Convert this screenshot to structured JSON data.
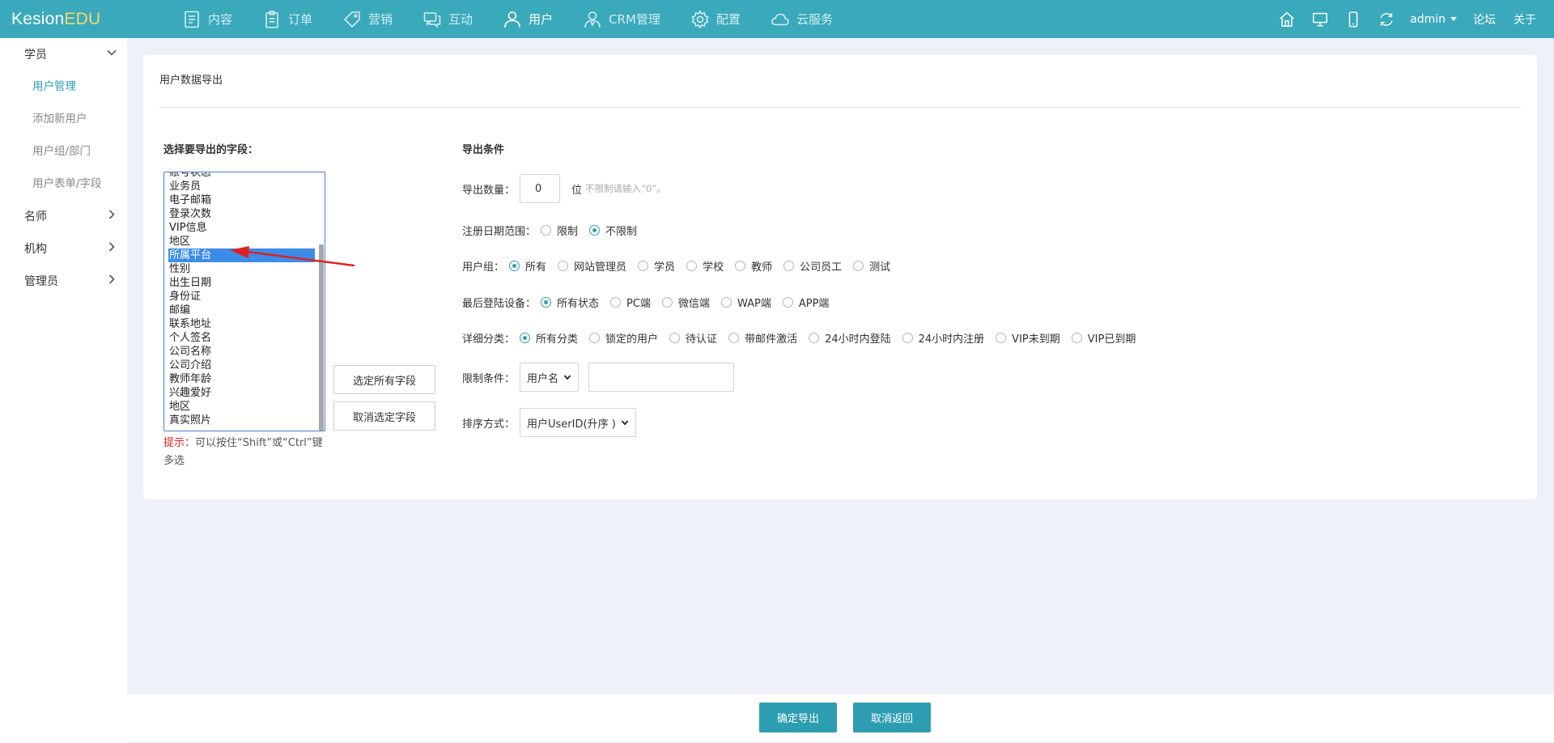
{
  "app": {
    "logo_main": "Kesion",
    "logo_accent": "EDU"
  },
  "nav": [
    {
      "label": "内容",
      "icon": "document-icon",
      "active": false
    },
    {
      "label": "订单",
      "icon": "clipboard-icon",
      "active": false
    },
    {
      "label": "营销",
      "icon": "tag-icon",
      "active": false
    },
    {
      "label": "互动",
      "icon": "chat-icon",
      "active": false
    },
    {
      "label": "用户",
      "icon": "user-icon",
      "active": true
    },
    {
      "label": "CRM管理",
      "icon": "crm-user-icon",
      "active": false
    },
    {
      "label": "配置",
      "icon": "gear-icon",
      "active": false
    },
    {
      "label": "云服务",
      "icon": "cloud-icon",
      "active": false
    }
  ],
  "topright": {
    "user": "admin",
    "forum": "论坛",
    "about": "关于"
  },
  "sidebar": {
    "groups": [
      {
        "label": "学员",
        "expanded": true,
        "items": [
          {
            "label": "用户管理",
            "active": true
          },
          {
            "label": "添加新用户",
            "active": false
          },
          {
            "label": "用户组/部门",
            "active": false
          },
          {
            "label": "用户表单/字段",
            "active": false
          }
        ]
      },
      {
        "label": "名师",
        "expanded": false
      },
      {
        "label": "机构",
        "expanded": false
      },
      {
        "label": "管理员",
        "expanded": false
      }
    ]
  },
  "page": {
    "title": "用户数据导出",
    "fields_label": "选择要导出的字段：",
    "fields": [
      "账号状态",
      "业务员",
      "电子邮箱",
      "登录次数",
      "VIP信息",
      "地区",
      "所属平台",
      "性别",
      "出生日期",
      "身份证",
      "邮编",
      "联系地址",
      "个人签名",
      "公司名称",
      "公司介绍",
      "教师年龄",
      "兴趣爱好",
      "地区",
      "真实照片"
    ],
    "selected_field": "所属平台",
    "hint_prefix": "提示：",
    "hint_text": "可以按住“Shift”或“Ctrl”键多选",
    "select_all_label": "选定所有字段",
    "deselect_label": "取消选定字段",
    "conditions_label": "导出条件",
    "count_label": "导出数量：",
    "count_value": "0",
    "count_unit": "位",
    "count_hint": "不限制请输入“0”。",
    "date_label": "注册日期范围：",
    "date_options": [
      {
        "label": "限制",
        "checked": false
      },
      {
        "label": "不限制",
        "checked": true
      }
    ],
    "group_label": "用户组：",
    "group_options": [
      {
        "label": "所有",
        "checked": true
      },
      {
        "label": "网站管理员",
        "checked": false
      },
      {
        "label": "学员",
        "checked": false
      },
      {
        "label": "学校",
        "checked": false
      },
      {
        "label": "教师",
        "checked": false
      },
      {
        "label": "公司员工",
        "checked": false
      },
      {
        "label": "测试",
        "checked": false
      }
    ],
    "device_label": "最后登陆设备：",
    "device_options": [
      {
        "label": "所有状态",
        "checked": true
      },
      {
        "label": "PC端",
        "checked": false
      },
      {
        "label": "微信端",
        "checked": false
      },
      {
        "label": "WAP端",
        "checked": false
      },
      {
        "label": "APP端",
        "checked": false
      }
    ],
    "category_label": "详细分类：",
    "category_options": [
      {
        "label": "所有分类",
        "checked": true
      },
      {
        "label": "锁定的用户",
        "checked": false
      },
      {
        "label": "待认证",
        "checked": false
      },
      {
        "label": "带邮件激活",
        "checked": false
      },
      {
        "label": "24小时内登陆",
        "checked": false
      },
      {
        "label": "24小时内注册",
        "checked": false
      },
      {
        "label": "VIP未到期",
        "checked": false
      },
      {
        "label": "VIP已到期",
        "checked": false
      }
    ],
    "limit_label": "限制条件：",
    "limit_select": "用户名",
    "limit_value": "",
    "sort_label": "排序方式：",
    "sort_select": "用户UserID(升序 )"
  },
  "footer": {
    "confirm_label": "确定导出",
    "cancel_label": "取消返回"
  },
  "colors": {
    "topbar": "#3aa9bb",
    "accent": "#2d9eb2",
    "logo_accent": "#f7d871",
    "selected": "#3d8ce8",
    "annotation": "#e02020"
  }
}
